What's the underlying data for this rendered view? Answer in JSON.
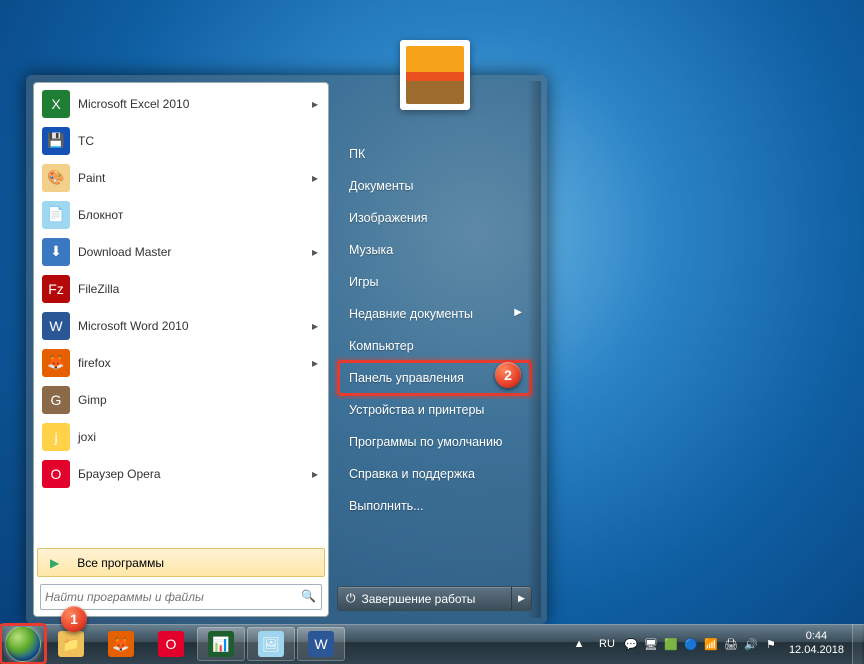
{
  "programs": [
    {
      "label": "Microsoft Excel 2010",
      "arrow": true,
      "icon_bg": "#1e7e34",
      "icon_txt": "X"
    },
    {
      "label": "TC",
      "arrow": false,
      "icon_bg": "#1552b5",
      "icon_txt": "💾"
    },
    {
      "label": "Paint",
      "arrow": true,
      "icon_bg": "#f2d08a",
      "icon_txt": "🎨"
    },
    {
      "label": "Блокнот",
      "arrow": false,
      "icon_bg": "#9fd6f0",
      "icon_txt": "📄"
    },
    {
      "label": "Download Master",
      "arrow": true,
      "icon_bg": "#3a78c2",
      "icon_txt": "⬇"
    },
    {
      "label": "FileZilla",
      "arrow": false,
      "icon_bg": "#b50808",
      "icon_txt": "Fz"
    },
    {
      "label": "Microsoft Word 2010",
      "arrow": true,
      "icon_bg": "#2b5797",
      "icon_txt": "W"
    },
    {
      "label": "firefox",
      "arrow": true,
      "icon_bg": "#e66000",
      "icon_txt": "🦊"
    },
    {
      "label": "Gimp",
      "arrow": false,
      "icon_bg": "#8a6a48",
      "icon_txt": "G"
    },
    {
      "label": "joxi",
      "arrow": false,
      "icon_bg": "#ffd24a",
      "icon_txt": "j"
    },
    {
      "label": "Браузер Opera",
      "arrow": true,
      "icon_bg": "#e3002b",
      "icon_txt": "O"
    }
  ],
  "all_programs": "Все программы",
  "search_placeholder": "Найти программы и файлы",
  "right_links": [
    {
      "label": "ПК",
      "arrow": false,
      "hl": false
    },
    {
      "label": "Документы",
      "arrow": false,
      "hl": false
    },
    {
      "label": "Изображения",
      "arrow": false,
      "hl": false
    },
    {
      "label": "Музыка",
      "arrow": false,
      "hl": false
    },
    {
      "label": "Игры",
      "arrow": false,
      "hl": false
    },
    {
      "label": "Недавние документы",
      "arrow": true,
      "hl": false
    },
    {
      "label": "Компьютер",
      "arrow": false,
      "hl": false
    },
    {
      "label": "Панель управления",
      "arrow": false,
      "hl": true
    },
    {
      "label": "Устройства и принтеры",
      "arrow": false,
      "hl": false
    },
    {
      "label": "Программы по умолчанию",
      "arrow": false,
      "hl": false
    },
    {
      "label": "Справка и поддержка",
      "arrow": false,
      "hl": false
    },
    {
      "label": "Выполнить...",
      "arrow": false,
      "hl": false
    }
  ],
  "shutdown_label": "Завершение работы",
  "taskbar": [
    {
      "name": "explorer",
      "bg": "#f0c15a",
      "txt": "📁",
      "active": false
    },
    {
      "name": "firefox",
      "bg": "#e66000",
      "txt": "🦊",
      "active": false
    },
    {
      "name": "opera",
      "bg": "#e3002b",
      "txt": "O",
      "active": false
    },
    {
      "name": "taskmgr",
      "bg": "#1e5e2e",
      "txt": "📊",
      "active": true
    },
    {
      "name": "paint",
      "bg": "#9fd5ee",
      "txt": "🖼",
      "active": true
    },
    {
      "name": "word",
      "bg": "#2b5797",
      "txt": "W",
      "active": true
    }
  ],
  "tray_up": "▲",
  "tray_lang": "RU",
  "tray_icons": [
    "💬",
    "🖥",
    "🟩",
    "🔵",
    "📶",
    "🖨",
    "🔊",
    "⚑"
  ],
  "clock_time": "0:44",
  "clock_date": "12.04.2018",
  "callouts": {
    "start": "1",
    "control_panel": "2"
  }
}
